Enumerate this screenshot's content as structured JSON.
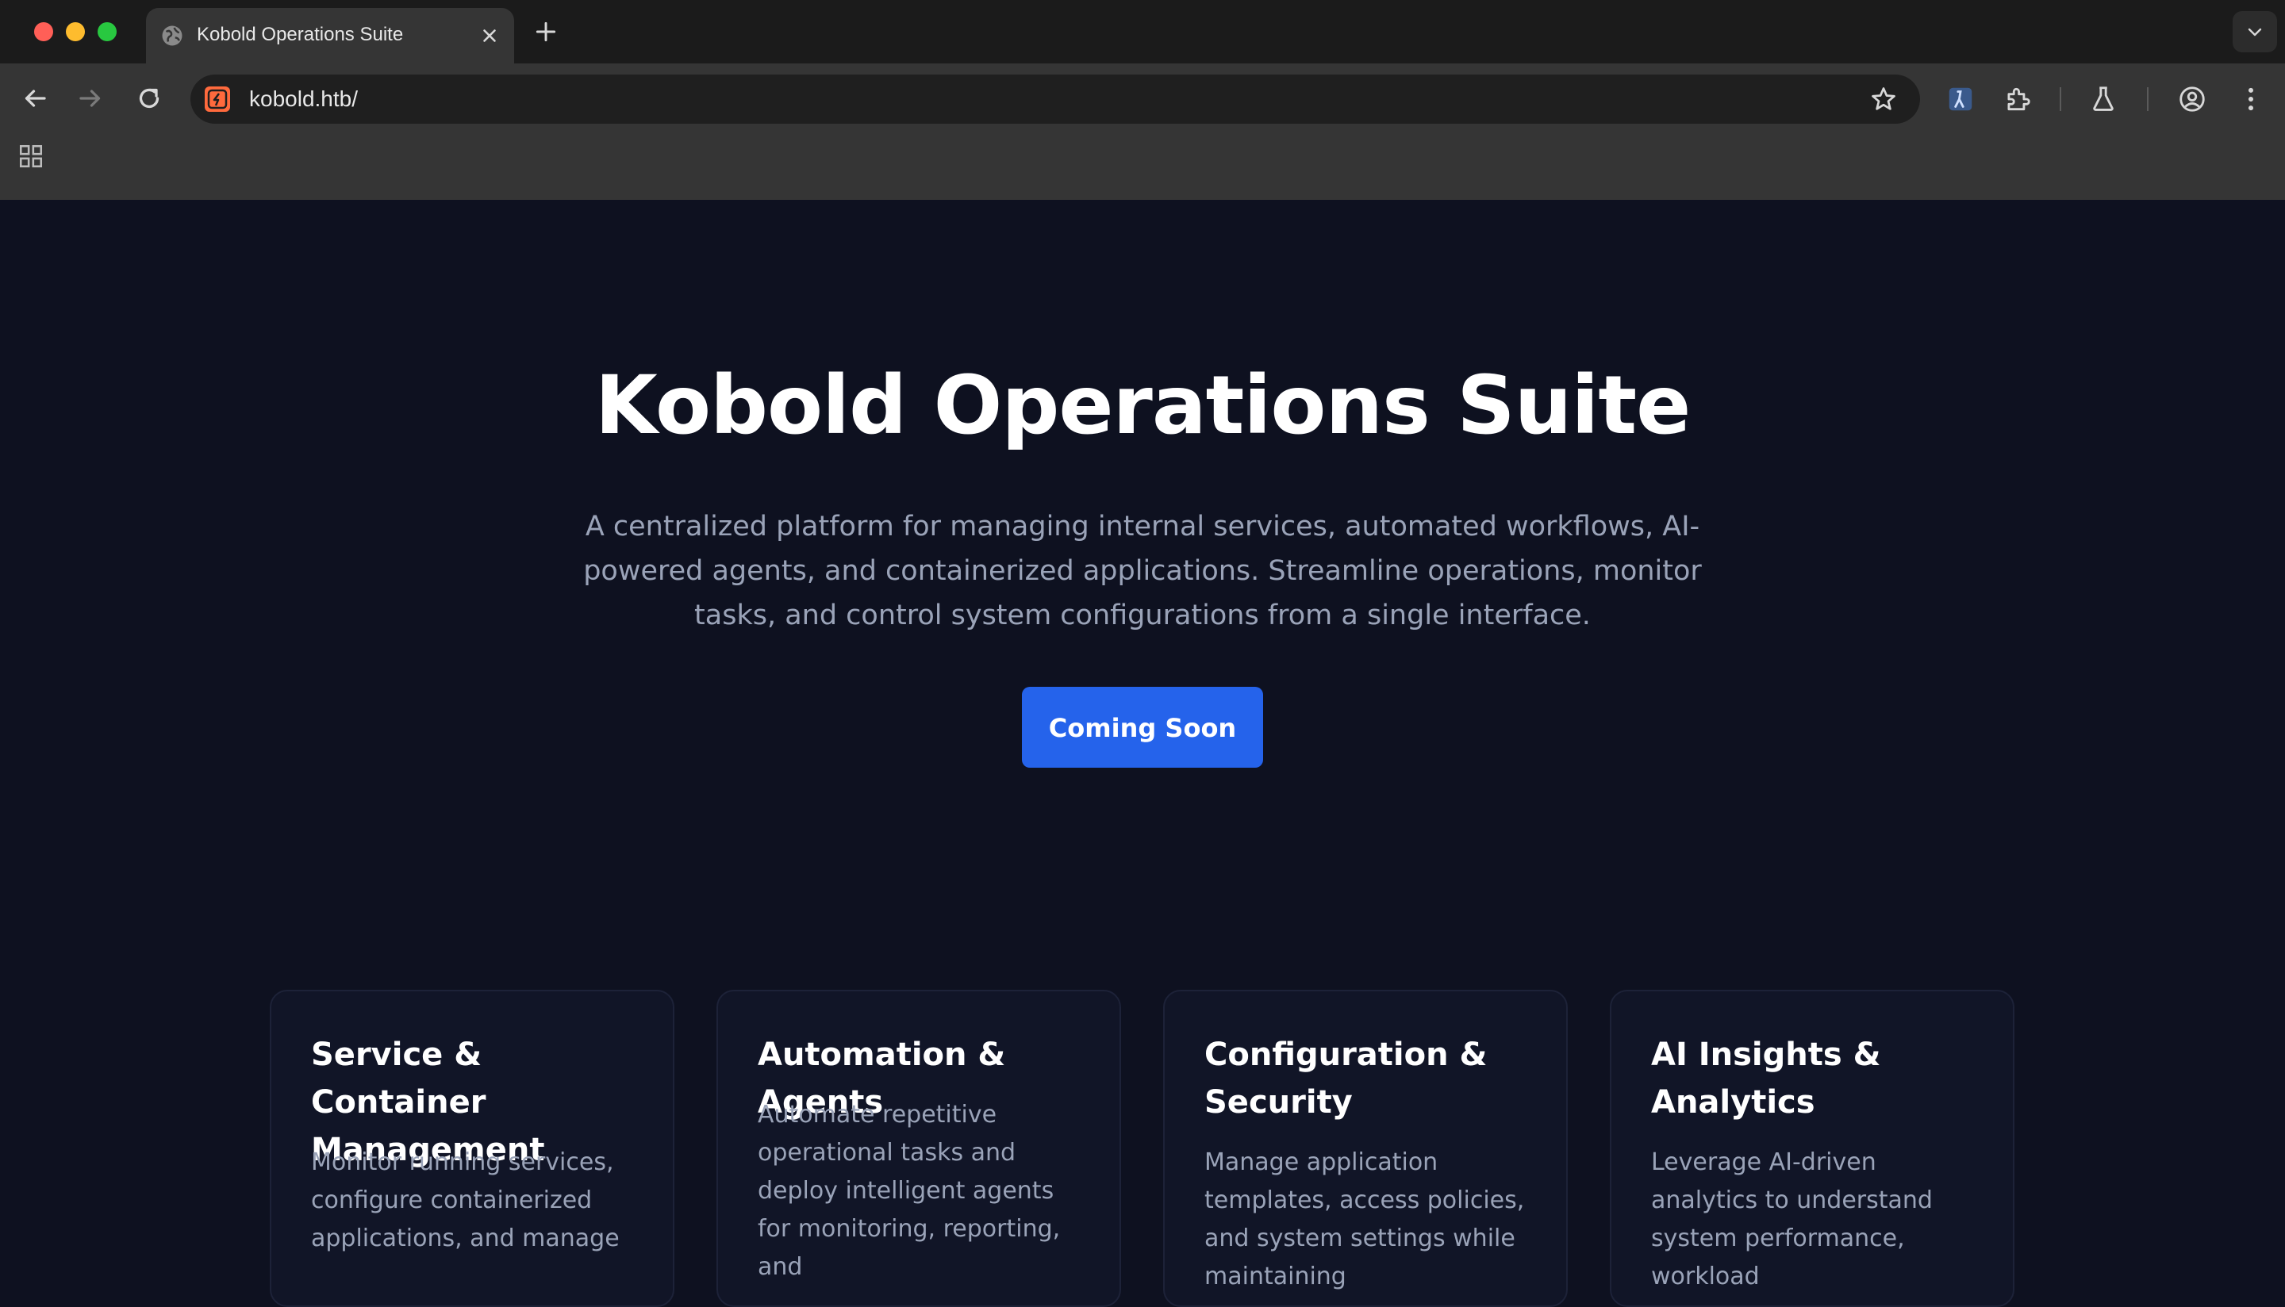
{
  "browser": {
    "tab_title": "Kobold Operations Suite",
    "url": "kobold.htb/"
  },
  "hero": {
    "title": "Kobold Operations Suite",
    "description": "A centralized platform for managing internal services, automated workflows, AI-powered agents, and containerized applications. Streamline operations, monitor tasks, and control system configurations from a single interface.",
    "cta_label": "Coming Soon"
  },
  "features": [
    {
      "title": "Service & Container Management",
      "description": "Monitor running services, configure containerized applications, and manage"
    },
    {
      "title": "Automation & Agents",
      "description": "Automate repetitive operational tasks and deploy intelligent agents for monitoring, reporting, and"
    },
    {
      "title": "Configuration & Security",
      "description": "Manage application templates, access policies, and system settings while maintaining"
    },
    {
      "title": "AI Insights & Analytics",
      "description": "Leverage AI-driven analytics to understand system performance, workload"
    }
  ],
  "colors": {
    "page_bg": "#0e1120",
    "accent": "#2563eb",
    "muted_text": "#9aa3b8"
  }
}
